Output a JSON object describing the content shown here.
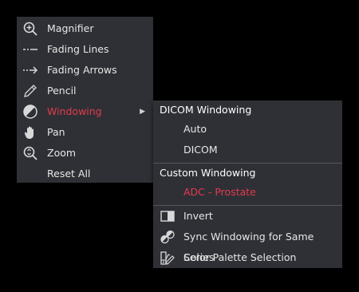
{
  "main_menu": {
    "items": [
      {
        "label": "Magnifier",
        "icon": "magnifier-plus-icon"
      },
      {
        "label": "Fading Lines",
        "icon": "fading-lines-icon"
      },
      {
        "label": "Fading Arrows",
        "icon": "fading-arrows-icon"
      },
      {
        "label": "Pencil",
        "icon": "pencil-icon"
      },
      {
        "label": "Windowing",
        "icon": "windowing-contrast-icon",
        "active": true,
        "has_submenu": true
      },
      {
        "label": "Pan",
        "icon": "hand-icon"
      },
      {
        "label": "Zoom",
        "icon": "zoom-icon"
      },
      {
        "label": "Reset All",
        "icon": ""
      }
    ],
    "submenu_arrow": "▶"
  },
  "sub_menu": {
    "dicom_heading": "DICOM Windowing",
    "dicom_items": [
      "Auto",
      "DICOM"
    ],
    "custom_heading": "Custom Windowing",
    "custom_items": [
      {
        "label": "ADC - Prostate",
        "selected": true
      }
    ],
    "actions": [
      {
        "label": "Invert",
        "icon": "invert-icon"
      },
      {
        "label": "Sync Windowing for Same Series",
        "icon": "sync-windowing-icon"
      },
      {
        "label": "Color Palette Selection",
        "icon": "color-palette-icon"
      }
    ]
  },
  "colors": {
    "menu_bg": "#2f3035",
    "accent": "#e23a50",
    "text": "#e6e6e6",
    "background": "#000000"
  }
}
